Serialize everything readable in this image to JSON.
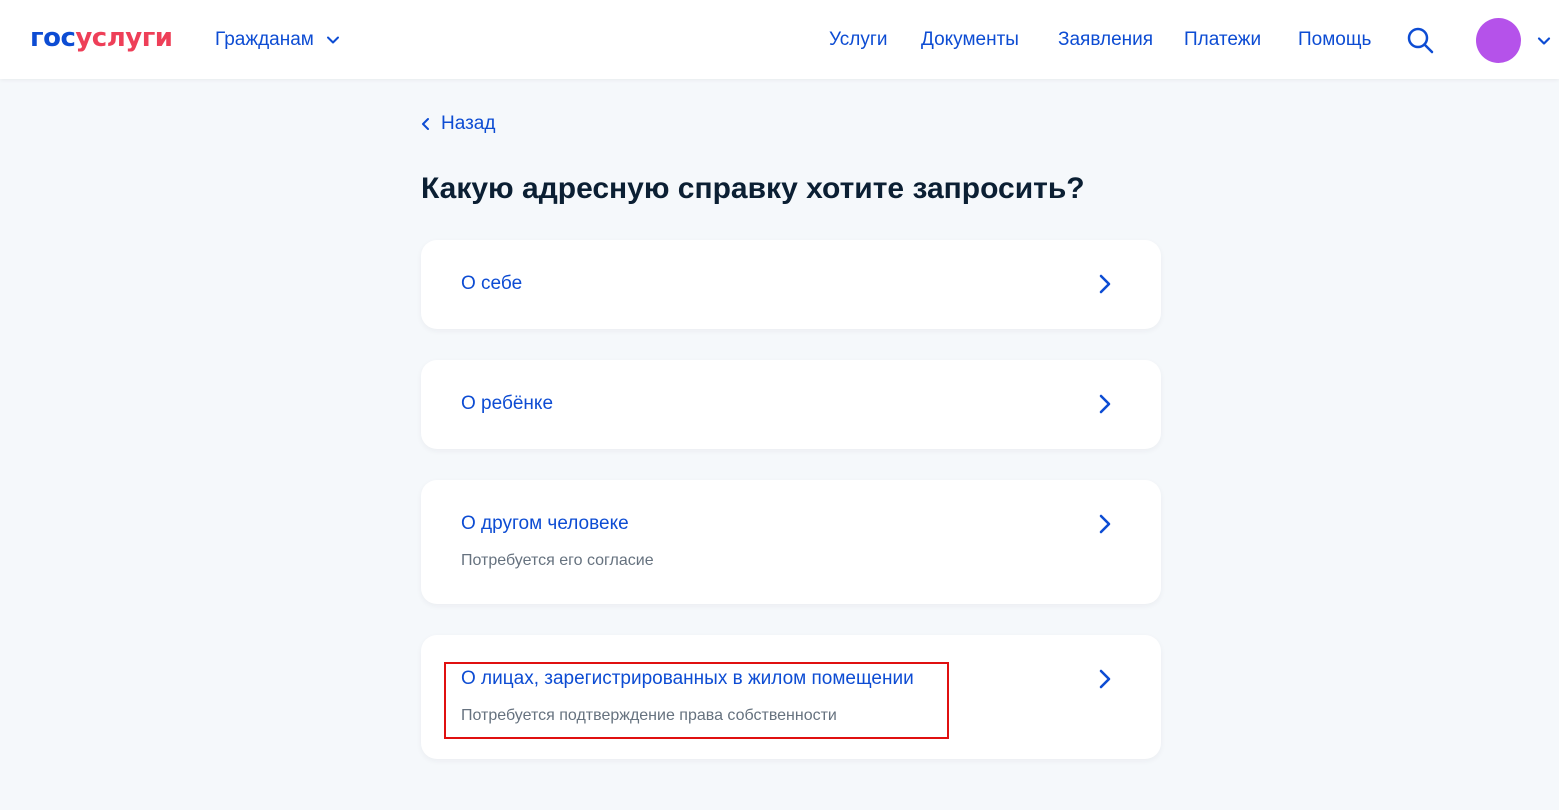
{
  "header": {
    "logo_part1": "гос",
    "logo_part2": "услуги",
    "audience_label": "Гражданам",
    "nav": [
      "Услуги",
      "Документы",
      "Заявления",
      "Платежи",
      "Помощь"
    ],
    "avatar_color": "#b552ea",
    "brand_blue": "#0d4cd3",
    "brand_red": "#ee3f58"
  },
  "main": {
    "back_label": "Назад",
    "title": "Какую адресную справку хотите запросить?",
    "options": [
      {
        "title": "О себе",
        "subtitle": ""
      },
      {
        "title": "О ребёнке",
        "subtitle": ""
      },
      {
        "title": "О другом человеке",
        "subtitle": "Потребуется его согласие"
      },
      {
        "title": "О лицах, зарегистрированных в жилом помещении",
        "subtitle": "Потребуется подтверждение права собственности"
      }
    ],
    "highlight_color": "#e01010"
  }
}
